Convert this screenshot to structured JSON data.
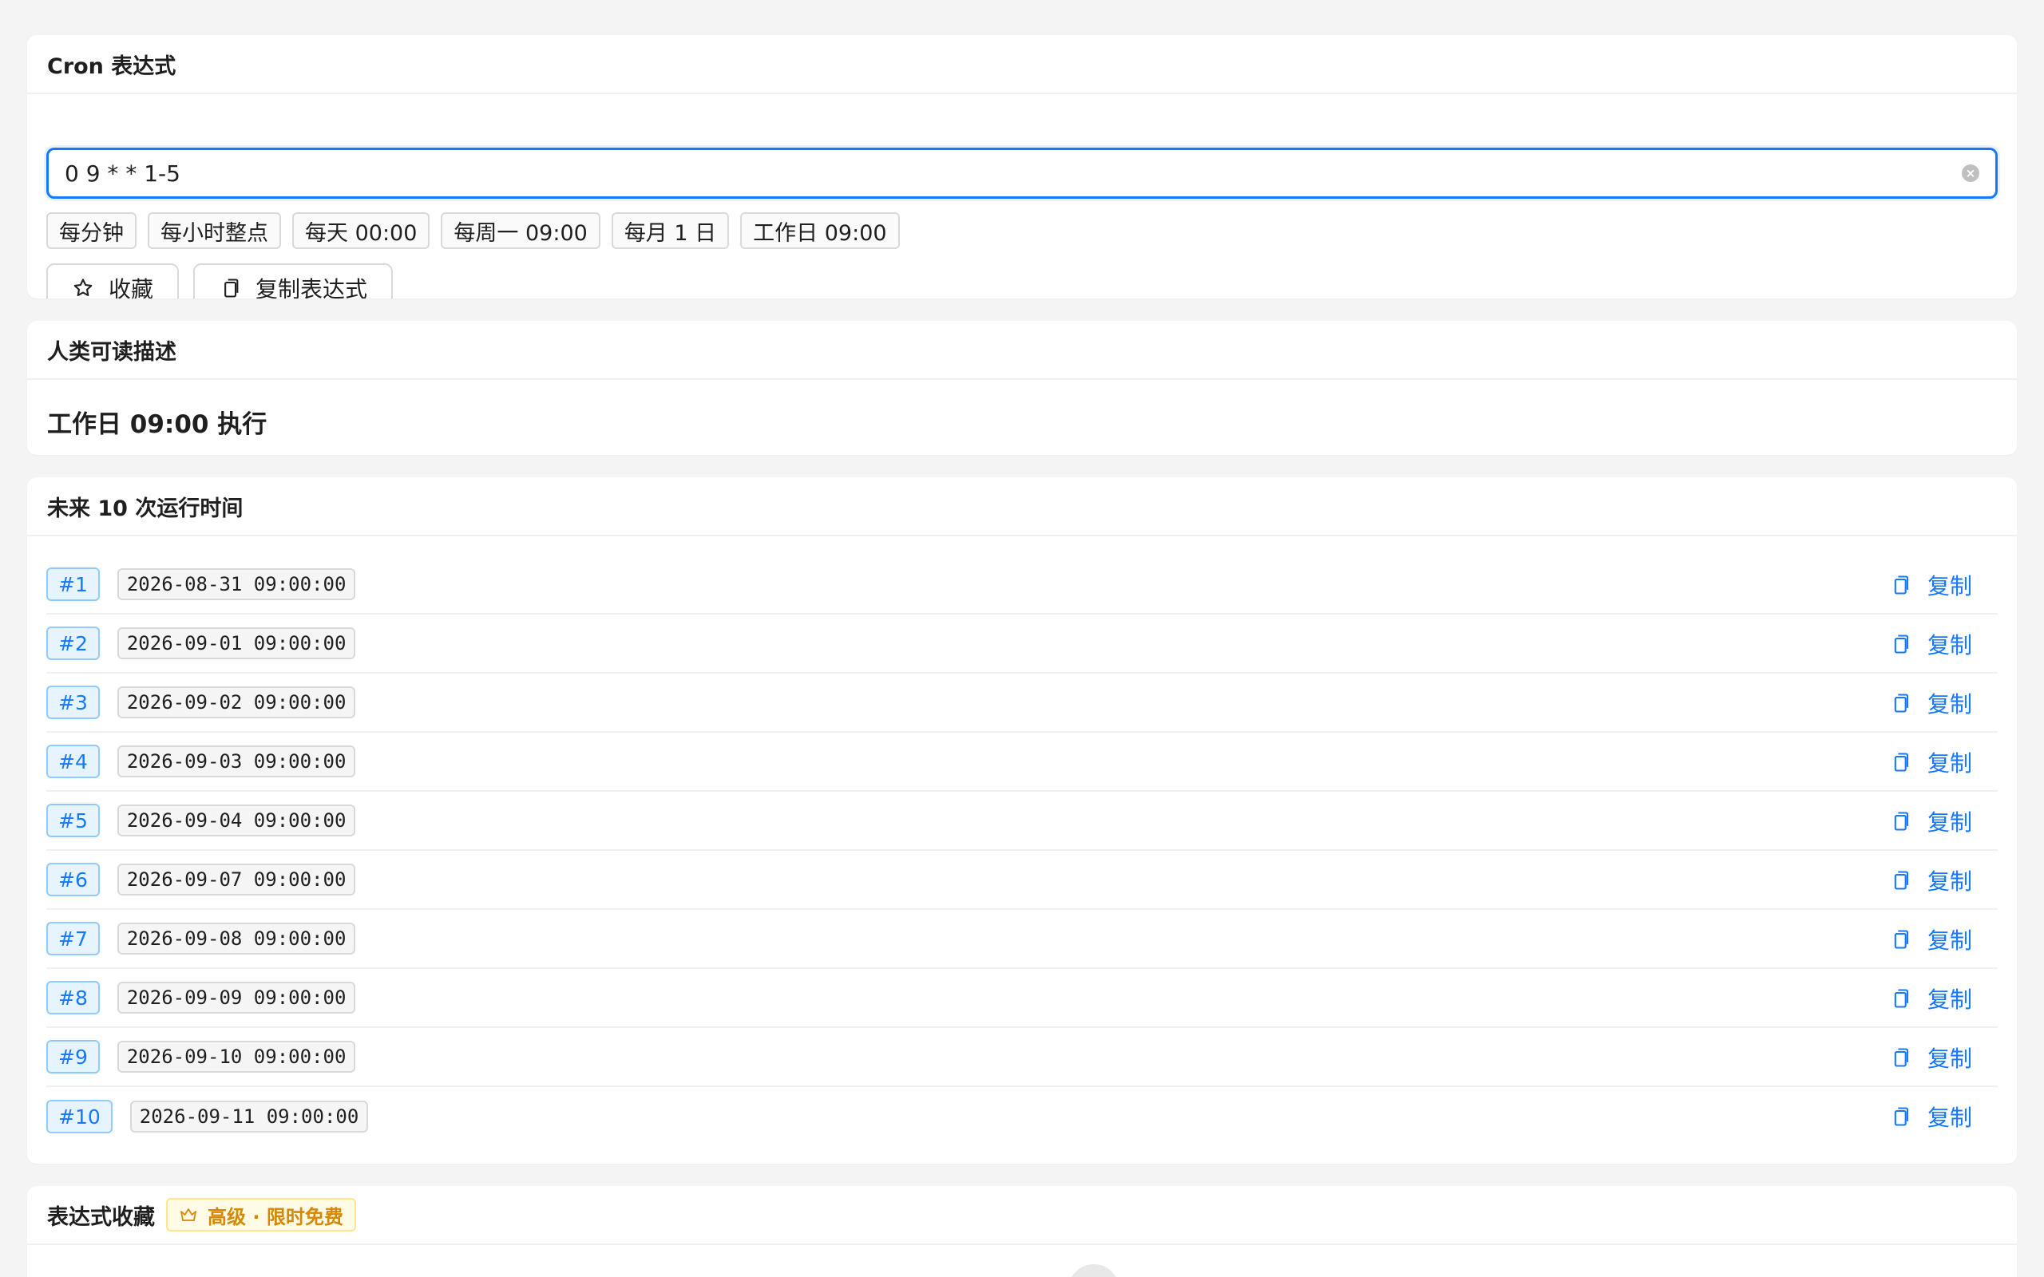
{
  "cron": {
    "title": "Cron 表达式",
    "input_value": "0 9 * * 1-5",
    "presets": [
      "每分钟",
      "每小时整点",
      "每天 00:00",
      "每周一 09:00",
      "每月 1 日",
      "工作日 09:00"
    ],
    "favorite_label": "收藏",
    "copy_expression_label": "复制表达式"
  },
  "human": {
    "title": "人类可读描述",
    "description": "工作日 09:00 执行"
  },
  "runs": {
    "title": "未来 10 次运行时间",
    "copy_label": "复制",
    "items": [
      {
        "index": "#1",
        "time": "2026-08-31 09:00:00"
      },
      {
        "index": "#2",
        "time": "2026-09-01 09:00:00"
      },
      {
        "index": "#3",
        "time": "2026-09-02 09:00:00"
      },
      {
        "index": "#4",
        "time": "2026-09-03 09:00:00"
      },
      {
        "index": "#5",
        "time": "2026-09-04 09:00:00"
      },
      {
        "index": "#6",
        "time": "2026-09-07 09:00:00"
      },
      {
        "index": "#7",
        "time": "2026-09-08 09:00:00"
      },
      {
        "index": "#8",
        "time": "2026-09-09 09:00:00"
      },
      {
        "index": "#9",
        "time": "2026-09-10 09:00:00"
      },
      {
        "index": "#10",
        "time": "2026-09-11 09:00:00"
      }
    ]
  },
  "favorites": {
    "title": "表达式收藏",
    "premium_tag": "高级 · 限时免费"
  },
  "icons": {
    "clear": "close-circle-icon",
    "favorite": "star-icon",
    "copy": "copy-icon",
    "premium": "crown-icon"
  },
  "colors": {
    "accent": "#1677ff",
    "badge_bg": "#e6f4ff",
    "premium": "#d48806",
    "premium_bg": "#fffbe6"
  }
}
